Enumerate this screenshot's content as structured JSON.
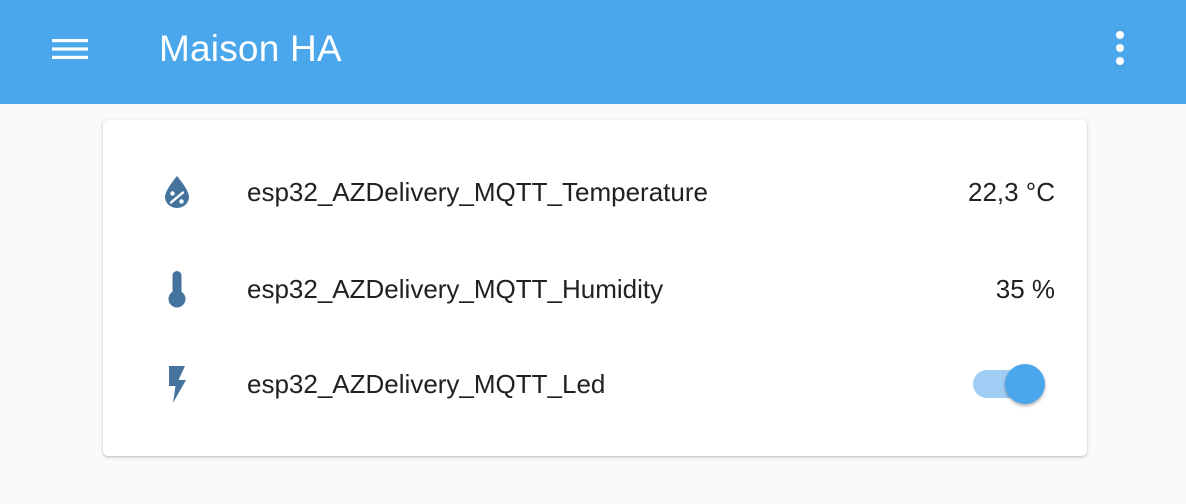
{
  "header": {
    "title": "Maison HA",
    "menu_icon": "hamburger-menu-icon",
    "overflow_icon": "dots-vertical-icon",
    "background_color": "#4aa7ec"
  },
  "entities": [
    {
      "name": "esp32_AZDelivery_MQTT_Temperature",
      "state": "22,3 °C",
      "icon": "water-percent-icon"
    },
    {
      "name": "esp32_AZDelivery_MQTT_Humidity",
      "state": "35 %",
      "icon": "thermometer-icon"
    },
    {
      "name": "esp32_AZDelivery_MQTT_Led",
      "icon": "flash-icon",
      "toggle_state": "on"
    }
  ],
  "colors": {
    "icon": "#44739e",
    "accent": "#4aa7ec",
    "toggle_track": "#a1cef4"
  }
}
